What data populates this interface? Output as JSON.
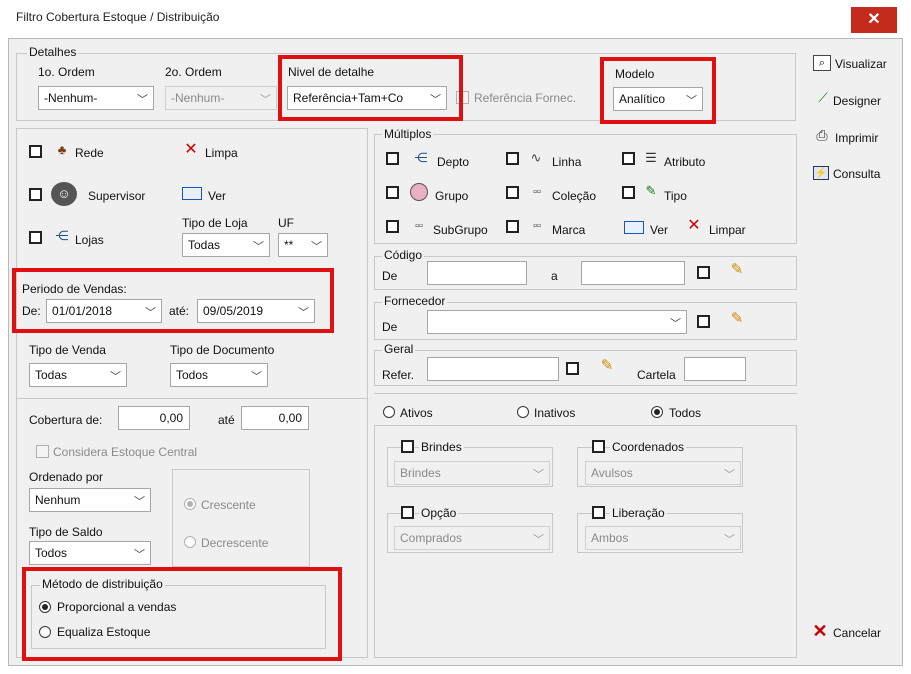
{
  "window": {
    "title": "Filtro Cobertura Estoque / Distribuição",
    "close": "✕"
  },
  "detalhes": {
    "legend": "Detalhes",
    "ordem1_label": "1o. Ordem",
    "ordem1_value": "-Nenhum-",
    "ordem2_label": "2o. Ordem",
    "ordem2_value": "-Nenhum-",
    "nivel_label": "Nivel de detalhe",
    "nivel_value": "Referência+Tam+Co",
    "ref_fornec_label": "Referência Fornec.",
    "modelo_label": "Modelo",
    "modelo_value": "Analítico"
  },
  "left": {
    "rede": "Rede",
    "limpa": "Limpa",
    "supervisor": "Supervisor",
    "ver": "Ver",
    "lojas": "Lojas",
    "tipo_loja_label": "Tipo de Loja",
    "tipo_loja_value": "Todas",
    "uf_label": "UF",
    "uf_value": "**",
    "periodo_label": "Periodo de Vendas:",
    "de_label": "De:",
    "de_value": "01/01/2018",
    "ate_label": "até:",
    "ate_value": "09/05/2019",
    "tipo_venda_label": "Tipo de Venda",
    "tipo_venda_value": "Todas",
    "tipo_doc_label": "Tipo de Documento",
    "tipo_doc_value": "Todos",
    "cobertura_label": "Cobertura de:",
    "cobertura_de": "0,00",
    "cobertura_ate_label": "até",
    "cobertura_ate": "0,00",
    "considera_label": "Considera Estoque Central",
    "ordenado_label": "Ordenado por",
    "ordenado_value": "Nenhum",
    "crescente": "Crescente",
    "decrescente": "Decrescente",
    "tipo_saldo_label": "Tipo de Saldo",
    "tipo_saldo_value": "Todos",
    "metodo_legend": "Método de distribuição",
    "metodo_opt1": "Proporcional a vendas",
    "metodo_opt2": "Equaliza Estoque"
  },
  "multiplos": {
    "legend": "Múltiplos",
    "depto": "Depto",
    "linha": "Linha",
    "atributo": "Atributo",
    "grupo": "Grupo",
    "colecao": "Coleção",
    "tipo": "Tipo",
    "subgrupo": "SubGrupo",
    "marca": "Marca",
    "ver": "Ver",
    "limpar": "Limpar"
  },
  "codigo": {
    "legend": "Código",
    "de_label": "De",
    "a_label": "a"
  },
  "fornecedor": {
    "legend": "Fornecedor",
    "de_label": "De"
  },
  "geral": {
    "legend": "Geral",
    "refer_label": "Refer.",
    "cartela_label": "Cartela"
  },
  "status": {
    "ativos": "Ativos",
    "inativos": "Inativos",
    "todos": "Todos"
  },
  "brindes": {
    "label": "Brindes",
    "value": "Brindes"
  },
  "coordenados": {
    "label": "Coordenados",
    "value": "Avulsos"
  },
  "opcao": {
    "label": "Opção",
    "value": "Comprados"
  },
  "liberacao": {
    "label": "Liberação",
    "value": "Ambos"
  },
  "actions": {
    "visualizar": "Visualizar",
    "designer": "Designer",
    "imprimir": "Imprimir",
    "consulta": "Consulta",
    "cancelar": "Cancelar"
  },
  "colors": {
    "highlight": "#e01010",
    "close_bg": "#c42b1c",
    "dialog_bg": "#f0f0f0"
  }
}
